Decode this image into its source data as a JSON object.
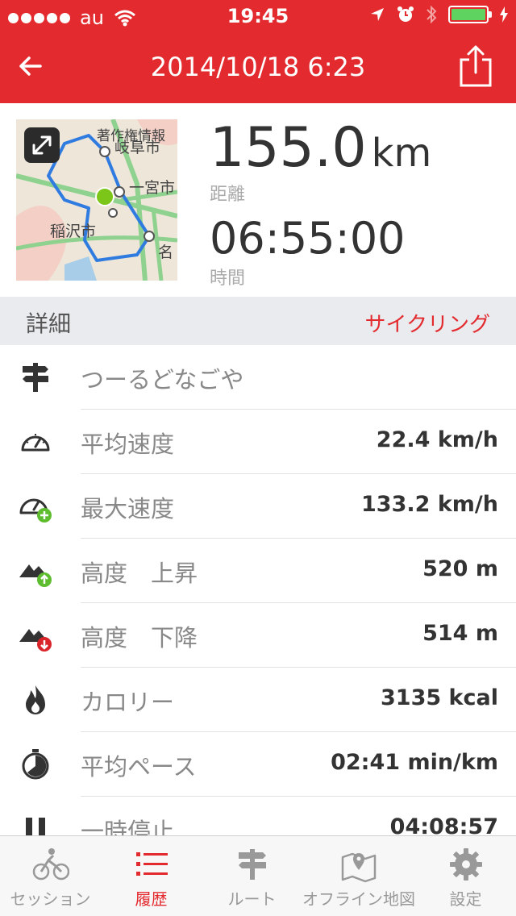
{
  "status_bar": {
    "carrier": "au",
    "time": "19:45"
  },
  "header": {
    "title": "2014/10/18 6:23"
  },
  "summary": {
    "distance_value": "155.0",
    "distance_unit": "km",
    "distance_label": "距離",
    "duration_value": "06:55:00",
    "duration_label": "時間"
  },
  "map": {
    "labels": [
      "著作権情報",
      "岐阜市",
      "一宮市",
      "稲沢市",
      "名"
    ]
  },
  "details": {
    "header": "詳細",
    "activity": "サイクリング"
  },
  "rows": [
    {
      "label": "つーるどなごや",
      "value": ""
    },
    {
      "label": "平均速度",
      "value": "22.4 km/h"
    },
    {
      "label": "最大速度",
      "value": "133.2 km/h"
    },
    {
      "label": "高度　上昇",
      "value": "520 m"
    },
    {
      "label": "高度　下降",
      "value": "514 m"
    },
    {
      "label": "カロリー",
      "value": "3135 kcal"
    },
    {
      "label": "平均ペース",
      "value": "02:41 min/km"
    },
    {
      "label": "一時停止",
      "value": "04:08:57"
    }
  ],
  "tabs": [
    {
      "label": "セッション"
    },
    {
      "label": "履歴"
    },
    {
      "label": "ルート"
    },
    {
      "label": "オフライン地図"
    },
    {
      "label": "設定"
    }
  ],
  "colors": {
    "accent": "#e32b2f",
    "route": "#2f7be0",
    "badge_green": "#5ebd2f",
    "badge_red": "#d9252a"
  }
}
